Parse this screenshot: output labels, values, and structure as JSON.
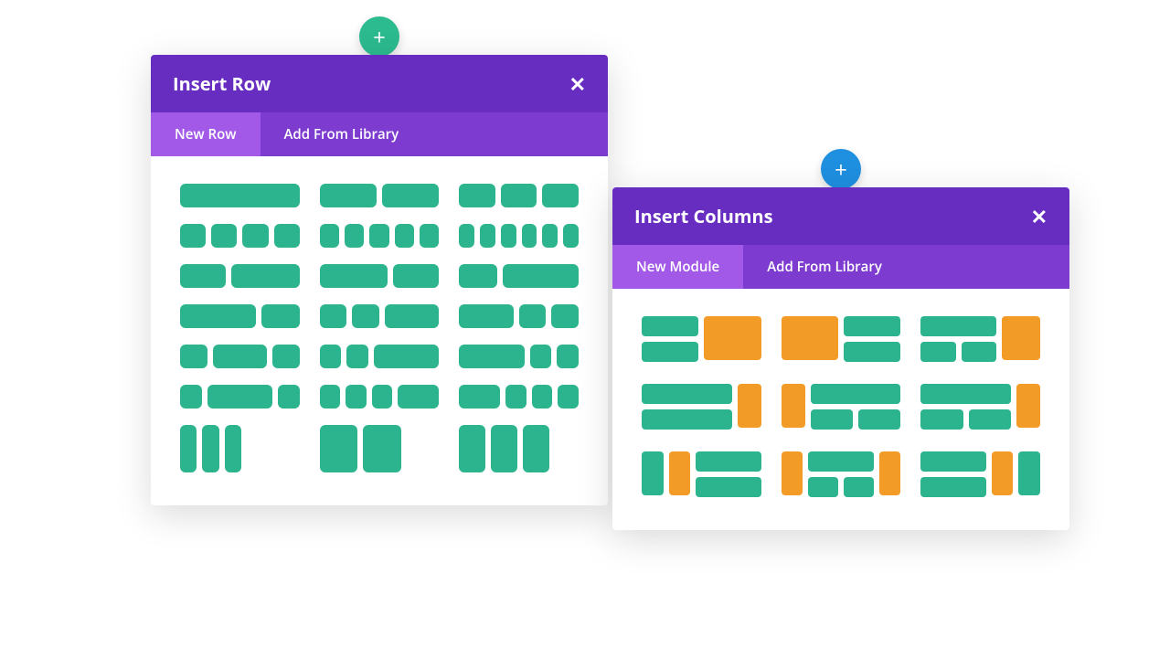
{
  "fab_plus": "+",
  "row_panel": {
    "title": "Insert Row",
    "close": "✕",
    "tabs": [
      "New Row",
      "Add From Library"
    ],
    "active_tab": 0
  },
  "col_panel": {
    "title": "Insert Columns",
    "close": "✕",
    "tabs": [
      "New Module",
      "Add From Library"
    ],
    "active_tab": 0
  },
  "colors": {
    "teal": "#2bb48d",
    "orange": "#f29b27",
    "purple_dark": "#672dc1",
    "purple_mid": "#7e3bd0",
    "purple_active": "#a259e8",
    "blue": "#1f8fe0"
  }
}
